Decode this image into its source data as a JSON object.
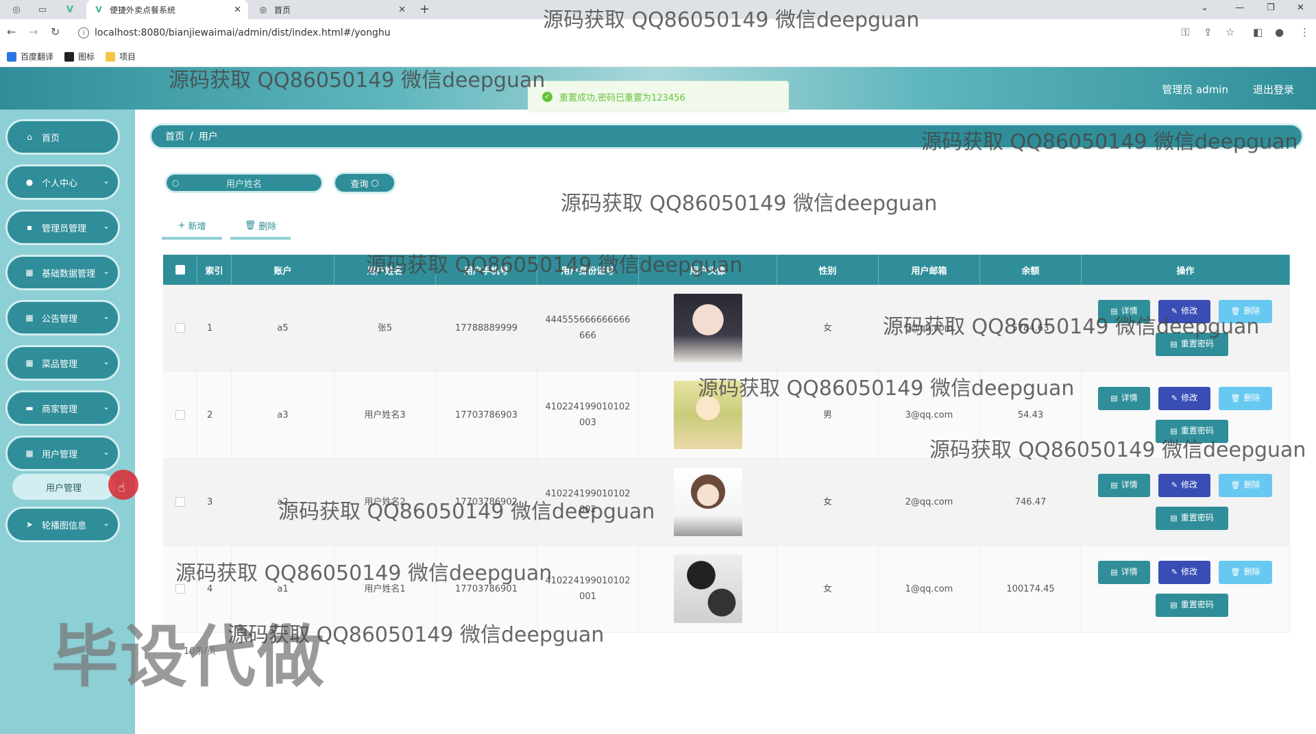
{
  "browser": {
    "tabs": [
      {
        "title": "便捷外卖点餐系统",
        "active": true
      },
      {
        "title": "首页",
        "active": false
      }
    ],
    "url": "localhost:8080/bianjiewaimai/admin/dist/index.html#/yonghu",
    "bookmarks": [
      "百度翻译",
      "图标",
      "项目"
    ]
  },
  "header": {
    "user": "管理员 admin",
    "logout": "退出登录"
  },
  "toast": {
    "message": "重置成功,密码已重置为123456",
    "color": "#67c23a"
  },
  "sidebar": {
    "items": [
      {
        "label": "首页",
        "icon": "home-icon"
      },
      {
        "label": "个人中心",
        "icon": "user-icon"
      },
      {
        "label": "管理员管理",
        "icon": "admin-icon"
      },
      {
        "label": "基础数据管理",
        "icon": "grid-icon"
      },
      {
        "label": "公告管理",
        "icon": "grid-icon"
      },
      {
        "label": "菜品管理",
        "icon": "grid-icon"
      },
      {
        "label": "商家管理",
        "icon": "chat-icon"
      },
      {
        "label": "用户管理",
        "icon": "grid-icon"
      },
      {
        "label": "轮播图信息",
        "icon": "send-icon"
      }
    ],
    "submenu_active": "用户管理"
  },
  "breadcrumb": {
    "home": "首页",
    "sep": "/",
    "current": "用户"
  },
  "search": {
    "placeholder": "用户姓名",
    "query_label": "查询"
  },
  "actions": {
    "add_label": "新增",
    "delete_label": "删除"
  },
  "table": {
    "headers": [
      "索引",
      "账户",
      "用户姓名",
      "用户手机号",
      "用户身份证号",
      "用户头像",
      "性别",
      "用户邮箱",
      "余额",
      "操作"
    ],
    "rows": [
      {
        "index": "1",
        "account": "a5",
        "name": "张5",
        "phone": "17788889999",
        "id_card": "444555666666666 666",
        "gender": "女",
        "email": "5@qq.com",
        "balance": "5784.63",
        "avatar": "avatar-girl-dark-hair"
      },
      {
        "index": "2",
        "account": "a3",
        "name": "用户姓名3",
        "phone": "17703786903",
        "id_card": "410224199010102 003",
        "gender": "男",
        "email": "3@qq.com",
        "balance": "54.43",
        "avatar": "avatar-anime-blonde"
      },
      {
        "index": "3",
        "account": "a2",
        "name": "用户姓名2",
        "phone": "17703786902",
        "id_card": "410224199010102 002",
        "gender": "女",
        "email": "2@qq.com",
        "balance": "746.47",
        "avatar": "avatar-cartoon-girl"
      },
      {
        "index": "4",
        "account": "a1",
        "name": "用户姓名1",
        "phone": "17703786901",
        "id_card": "410224199010102 001",
        "gender": "女",
        "email": "1@qq.com",
        "balance": "100174.45",
        "avatar": "avatar-silhouette"
      }
    ],
    "row_buttons": {
      "detail": "详情",
      "edit": "修改",
      "delete": "删除",
      "reset": "重置密码"
    }
  },
  "pager": {
    "text": "10条/页"
  },
  "watermarks": {
    "small": "源码获取 QQ86050149 微信deepguan",
    "big": "毕设代做"
  },
  "colors": {
    "primary": "#2f8e99",
    "sidebar_bg": "#8ccfd5",
    "edit": "#3a4db5",
    "delete": "#67c9f0"
  }
}
